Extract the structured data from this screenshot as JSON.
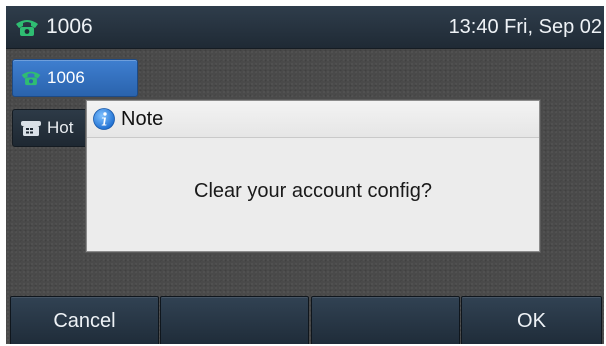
{
  "status_bar": {
    "account": "1006",
    "datetime": "13:40 Fri, Sep 02",
    "icon": "phone-handset-icon"
  },
  "line_keys": [
    {
      "label": "1006",
      "icon": "phone-handset-icon",
      "state": "active"
    },
    {
      "label": "Hot",
      "icon": "hotline-phone-icon",
      "state": "normal"
    }
  ],
  "dialog": {
    "title": "Note",
    "icon": "info-icon",
    "message": "Clear your account config?"
  },
  "softkeys": [
    "Cancel",
    "",
    "",
    "OK"
  ],
  "colors": {
    "accent_blue": "#3677c9",
    "status_green": "#24b36a",
    "bar_dark": "#253340"
  }
}
